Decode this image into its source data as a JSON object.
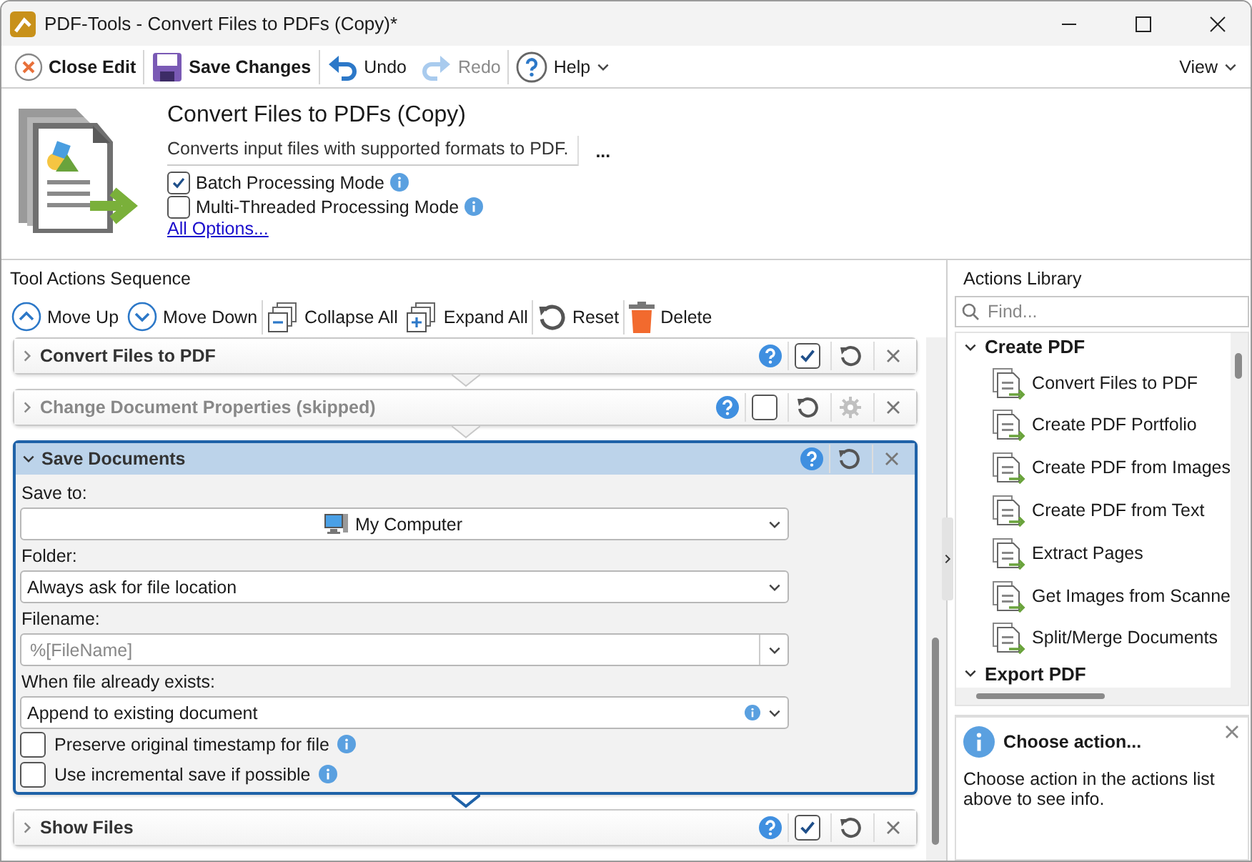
{
  "window": {
    "title": "PDF-Tools - Convert Files to PDFs (Copy)*"
  },
  "toolbar": {
    "items": [
      {
        "kind": "close",
        "label": "Close Edit",
        "disabled": false
      },
      {
        "kind": "save",
        "label": "Save Changes",
        "disabled": false
      },
      {
        "kind": "undo",
        "label": "Undo",
        "disabled": false
      },
      {
        "kind": "redo",
        "label": "Redo",
        "disabled": true
      },
      {
        "kind": "help",
        "label": "Help",
        "disabled": false
      }
    ],
    "view": "View"
  },
  "header": {
    "title": "Convert Files to PDFs (Copy)",
    "description": "Converts input files with supported formats to PDF.",
    "more": "...",
    "options": [
      {
        "label": "Batch Processing Mode",
        "checked": true
      },
      {
        "label": "Multi-Threaded Processing Mode",
        "checked": false
      }
    ],
    "link": "All Options..."
  },
  "sequence": {
    "title": "Tool Actions Sequence",
    "toolbar": [
      {
        "kind": "up",
        "label": "Move Up"
      },
      {
        "kind": "down",
        "label": "Move Down"
      },
      {
        "kind": "collapse",
        "label": "Collapse All"
      },
      {
        "kind": "expand",
        "label": "Expand All"
      },
      {
        "kind": "reset",
        "label": "Reset"
      },
      {
        "kind": "delete",
        "label": "Delete"
      }
    ],
    "actions": [
      {
        "title": "Convert Files to PDF",
        "expanded": false,
        "skipped": false,
        "checked": true,
        "settings": false
      },
      {
        "title": "Change Document Properties (skipped)",
        "expanded": false,
        "skipped": true,
        "checked": false,
        "settings": true
      },
      {
        "title": "Save Documents",
        "expanded": true,
        "skipped": false,
        "fields": [
          {
            "label": "Save to:",
            "kind": "target",
            "value": "My Computer"
          },
          {
            "label": "Folder:",
            "kind": "select",
            "value": "Always ask for file location"
          },
          {
            "label": "Filename:",
            "kind": "combo",
            "placeholder": "%[FileName]"
          },
          {
            "label": "When file already exists:",
            "kind": "select-info",
            "value": "Append to existing document"
          }
        ],
        "checkboxes": [
          {
            "label": "Preserve original timestamp for file",
            "checked": false
          },
          {
            "label": "Use incremental save if possible",
            "checked": false
          }
        ]
      },
      {
        "title": "Show Files",
        "expanded": false,
        "skipped": false,
        "checked": true,
        "settings": false
      }
    ]
  },
  "library": {
    "title": "Actions Library",
    "search": {
      "placeholder": "Find..."
    },
    "groups": [
      {
        "title": "Create PDF",
        "expanded": true,
        "items": [
          "Convert Files to PDF",
          "Create PDF Portfolio",
          "Create PDF from Images",
          "Create PDF from Text",
          "Extract Pages",
          "Get Images from Scanne",
          "Split/Merge Documents"
        ]
      },
      {
        "title": "Export PDF",
        "expanded": true
      }
    ],
    "info": {
      "title": "Choose action...",
      "text": "Choose action in the actions list above to see info."
    }
  }
}
